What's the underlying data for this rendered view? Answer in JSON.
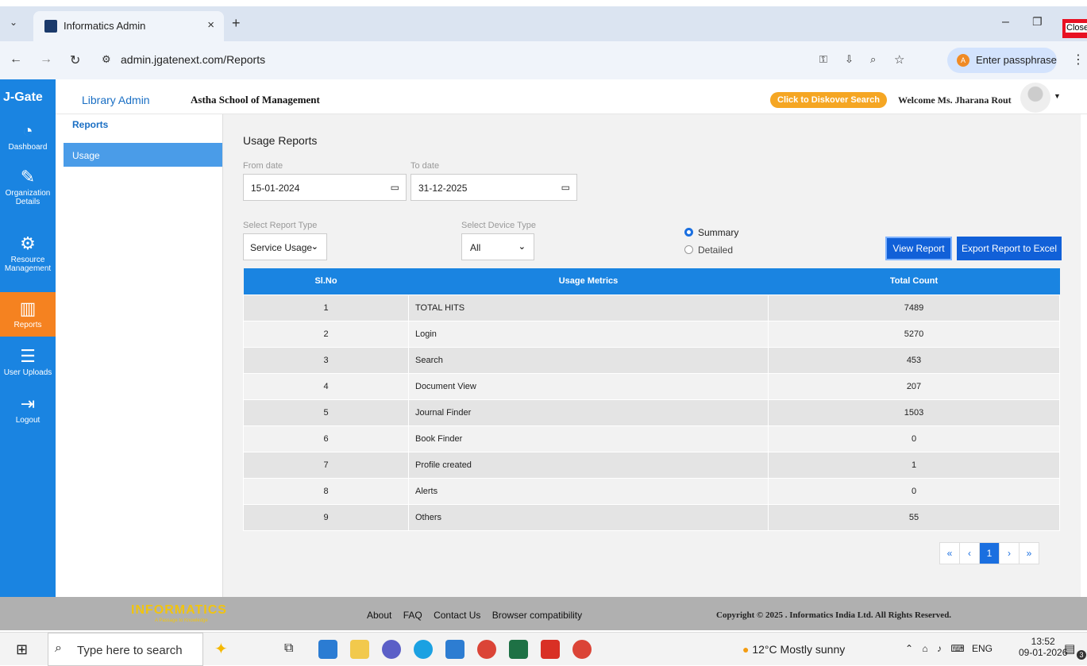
{
  "browser": {
    "tab_title": "Informatics Admin",
    "url": "admin.jgatenext.com/Reports",
    "passphrase_label": "Enter passphrase",
    "passphrase_avatar": "A",
    "close_tooltip": "Close"
  },
  "header": {
    "logo_text": "J-Gate",
    "app_section": "Library Admin",
    "organization": "Astha School of Management",
    "discover_button": "Click to Diskover Search",
    "welcome": "Welcome Ms. Jharana Rout"
  },
  "leftnav": [
    {
      "label": "Dashboard",
      "icon": "speedometer-icon",
      "active": false
    },
    {
      "label": "Organization Details",
      "icon": "user-edit-icon",
      "active": false
    },
    {
      "label": "Resource Management",
      "icon": "user-gear-icon",
      "active": false
    },
    {
      "label": "Reports",
      "icon": "bar-chart-icon",
      "active": true
    },
    {
      "label": "User Uploads",
      "icon": "upload-list-icon",
      "active": false
    },
    {
      "label": "Logout",
      "icon": "logout-icon",
      "active": false
    }
  ],
  "submenu": {
    "heading": "Reports",
    "items": [
      "Usage"
    ]
  },
  "report": {
    "title": "Usage Reports",
    "from_label": "From date",
    "from_value": "15-01-2024",
    "to_label": "To date",
    "to_value": "31-12-2025",
    "report_type_label": "Select Report Type",
    "report_type_value": "Service Usage",
    "device_type_label": "Select Device Type",
    "device_type_value": "All",
    "radio_summary": "Summary",
    "radio_detailed": "Detailed",
    "view_button": "View Report",
    "export_button": "Export Report to Excel"
  },
  "table": {
    "headers": [
      "Sl.No",
      "Usage Metrics",
      "Total Count"
    ],
    "rows": [
      [
        "1",
        "TOTAL HITS",
        "7489"
      ],
      [
        "2",
        "Login",
        "5270"
      ],
      [
        "3",
        "Search",
        "453"
      ],
      [
        "4",
        "Document View",
        "207"
      ],
      [
        "5",
        "Journal Finder",
        "1503"
      ],
      [
        "6",
        "Book Finder",
        "0"
      ],
      [
        "7",
        "Profile created",
        "1"
      ],
      [
        "8",
        "Alerts",
        "0"
      ],
      [
        "9",
        "Others",
        "55"
      ]
    ]
  },
  "pagination": {
    "first": "«",
    "prev": "‹",
    "current": "1",
    "next": "›",
    "last": "»"
  },
  "footer": {
    "brand": "INFORMATICS",
    "tagline": "A Passage to Knowledge",
    "links": [
      "About",
      "FAQ",
      "Contact Us",
      "Browser compatibility"
    ],
    "copyright": "Copyright © 2025 . Informatics India Ltd. All Rights Reserved."
  },
  "taskbar": {
    "search_placeholder": "Type here to search",
    "weather": "12°C  Mostly sunny",
    "lang": "ENG",
    "time": "13:52",
    "date": "09-01-2026",
    "notification_count": "3"
  },
  "colors": {
    "primary_blue": "#1a84e1",
    "active_orange": "#f58220",
    "button_blue": "#1160d8",
    "discover_orange": "#f5a623"
  }
}
